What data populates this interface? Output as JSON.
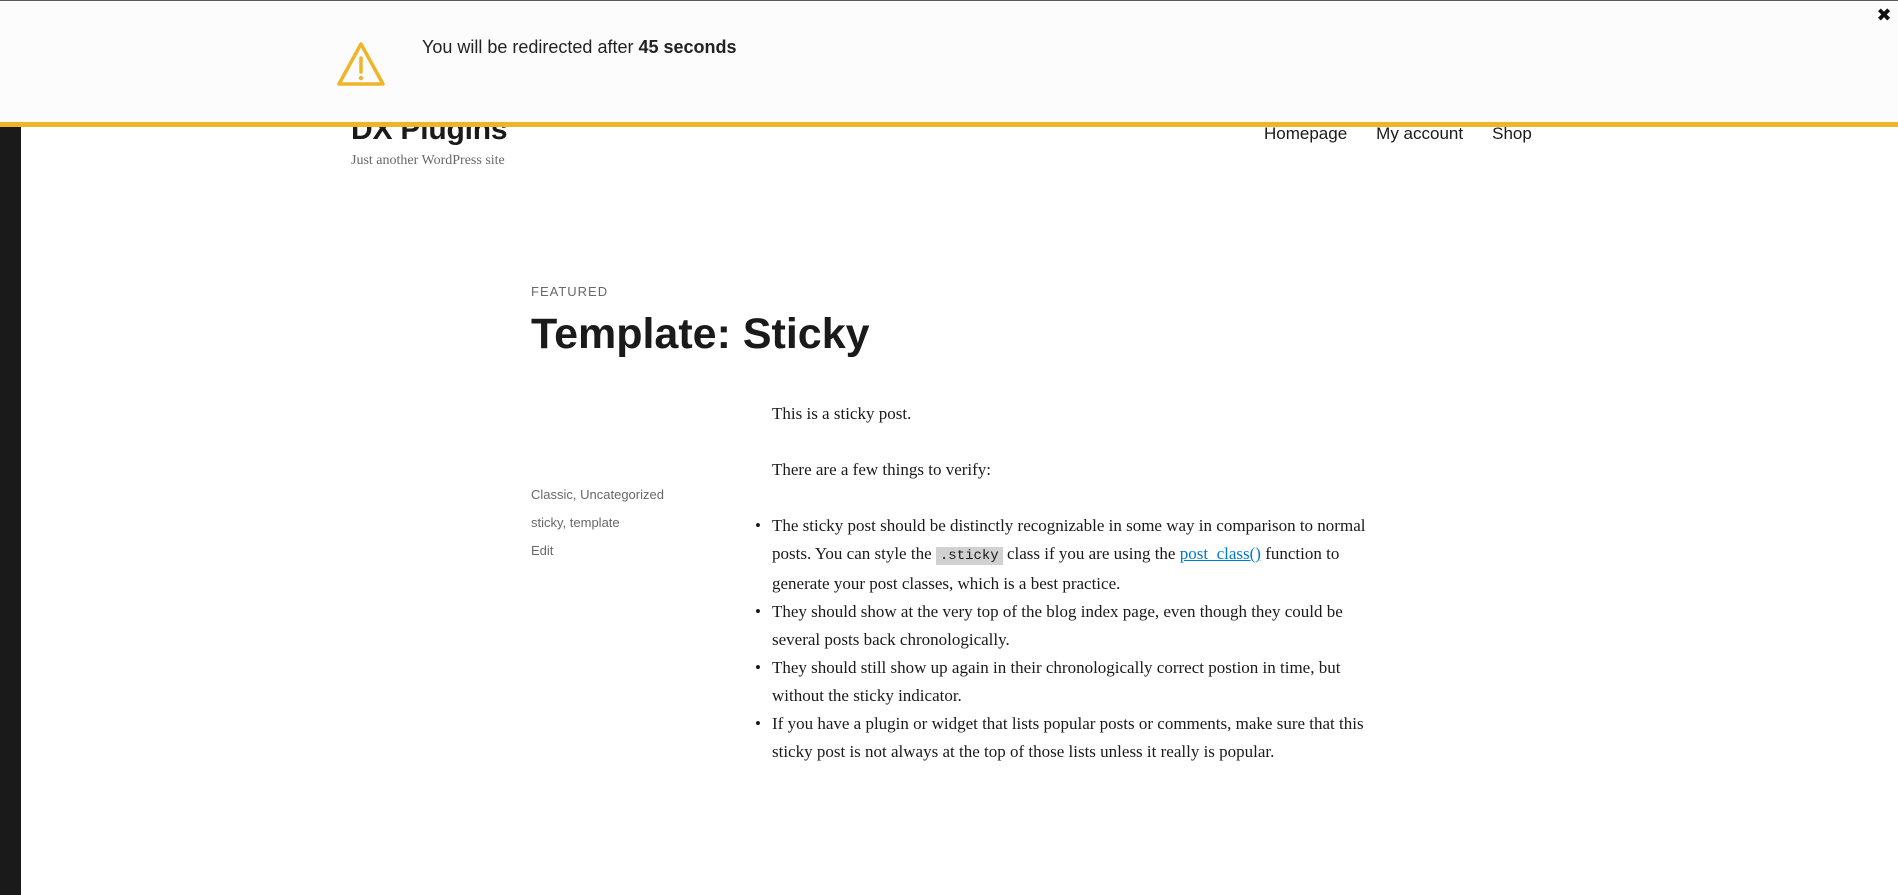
{
  "notice": {
    "text_prefix": "You will be redirected after",
    "countdown": "45 seconds",
    "close_glyph": "✖",
    "accent_color": "#f0b429",
    "icon": "warning-triangle-icon"
  },
  "site": {
    "title": "DX Plugins",
    "description": "Just another WordPress site"
  },
  "nav": {
    "items": [
      "Homepage",
      "My account",
      "Shop"
    ]
  },
  "post": {
    "kicker": "FEATURED",
    "title": "Template: Sticky",
    "meta": {
      "categories": [
        "Classic",
        "Uncategorized"
      ],
      "tags": [
        "sticky",
        "template"
      ],
      "edit_label": "Edit"
    },
    "content": {
      "p1": "This is a sticky post.",
      "p2": "There are a few things to verify:",
      "li1_a": "The sticky post should be distinctly recognizable in some way in comparison to normal posts. You can style the ",
      "li1_code": ".sticky",
      "li1_b": " class if you are using the ",
      "li1_link": "post_class()",
      "li1_c": " function to generate your post classes, which is a best practice.",
      "li2": "They should show at the very top of the blog index page, even though they could be several posts back chronologically.",
      "li3": "They should still show up again in their chronologically correct postion in time, but without the sticky indicator.",
      "li4": "If you have a plugin or widget that lists popular posts or comments, make sure that this sticky post is not always at the top of those lists unless it really is popular.",
      "bullet": "•"
    }
  }
}
